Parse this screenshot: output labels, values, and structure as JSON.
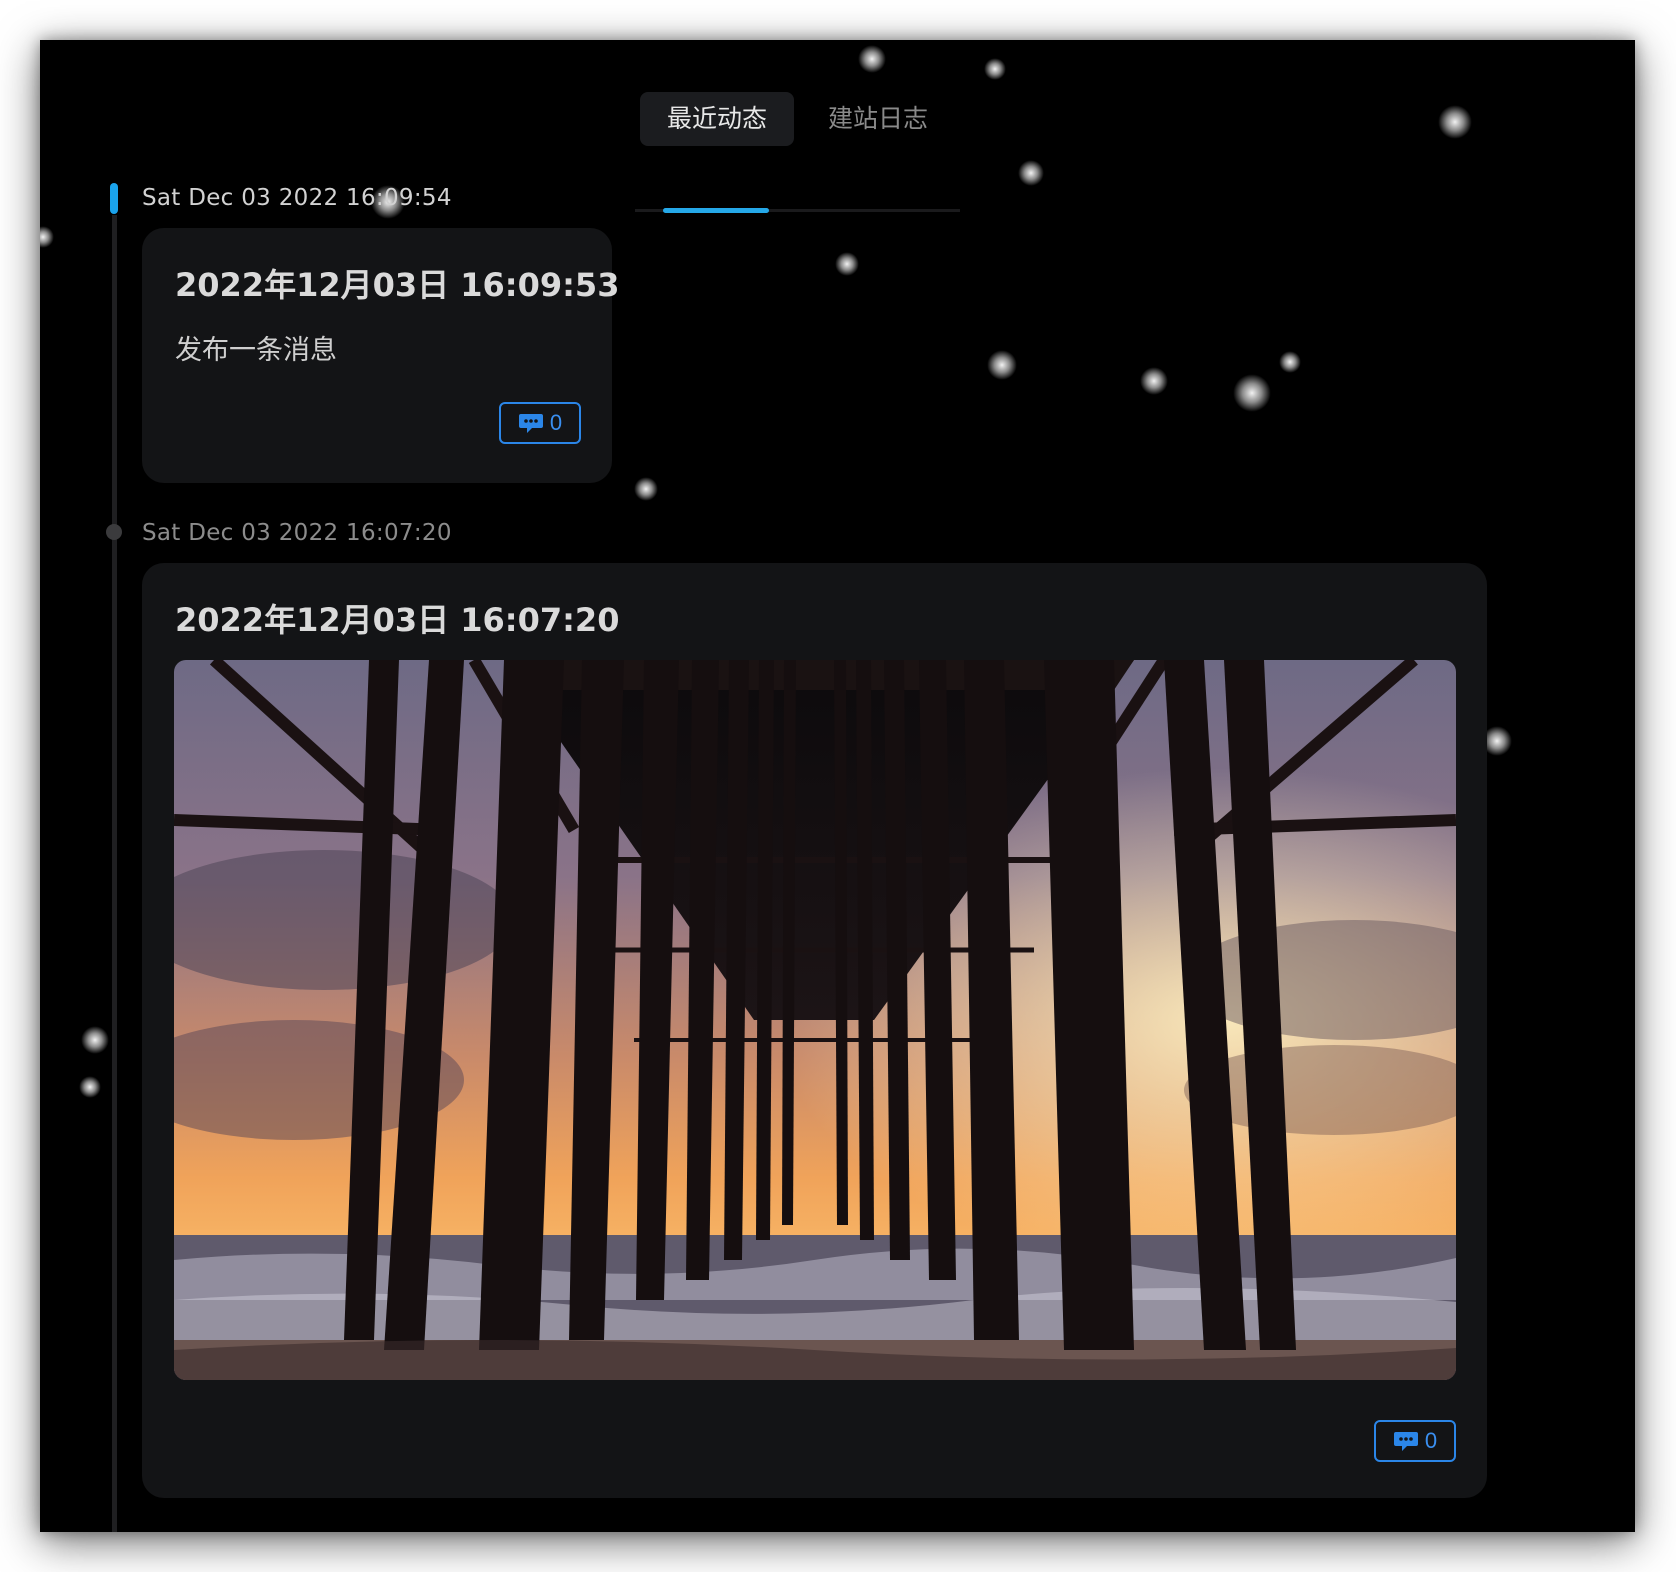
{
  "tabs": [
    {
      "label": "最近动态",
      "active": true
    },
    {
      "label": "建站日志",
      "active": false
    }
  ],
  "colors": {
    "accent": "#25a8e8",
    "comment": "#2b86e8",
    "card": "#131416",
    "background": "#000000"
  },
  "posts": [
    {
      "time": "Sat Dec 03 2022 16:09:54",
      "title": "2022年12月03日 16:09:53",
      "text": "发布一条消息",
      "comments": "0",
      "comment_icon": "chat-bubble-icon"
    },
    {
      "time": "Sat Dec 03 2022 16:07:20",
      "title": "2022年12月03日 16:07:20",
      "image": "pier-sunset-photo",
      "comments": "0",
      "comment_icon": "chat-bubble-icon"
    }
  ]
}
